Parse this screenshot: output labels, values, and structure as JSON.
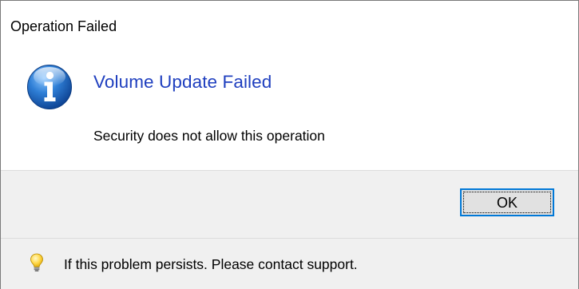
{
  "dialog": {
    "title": "Operation Failed",
    "main_instruction": "Volume Update Failed",
    "content": "Security does not allow this operation",
    "ok_label": "OK",
    "footer_text": "If this problem persists. Please contact support.",
    "main_icon": "information-icon",
    "footer_icon": "lightbulb-icon"
  },
  "colors": {
    "main_instruction": "#1f3fbf",
    "button_focus_border": "#0078d7",
    "panel_background": "#f0f0f0"
  }
}
